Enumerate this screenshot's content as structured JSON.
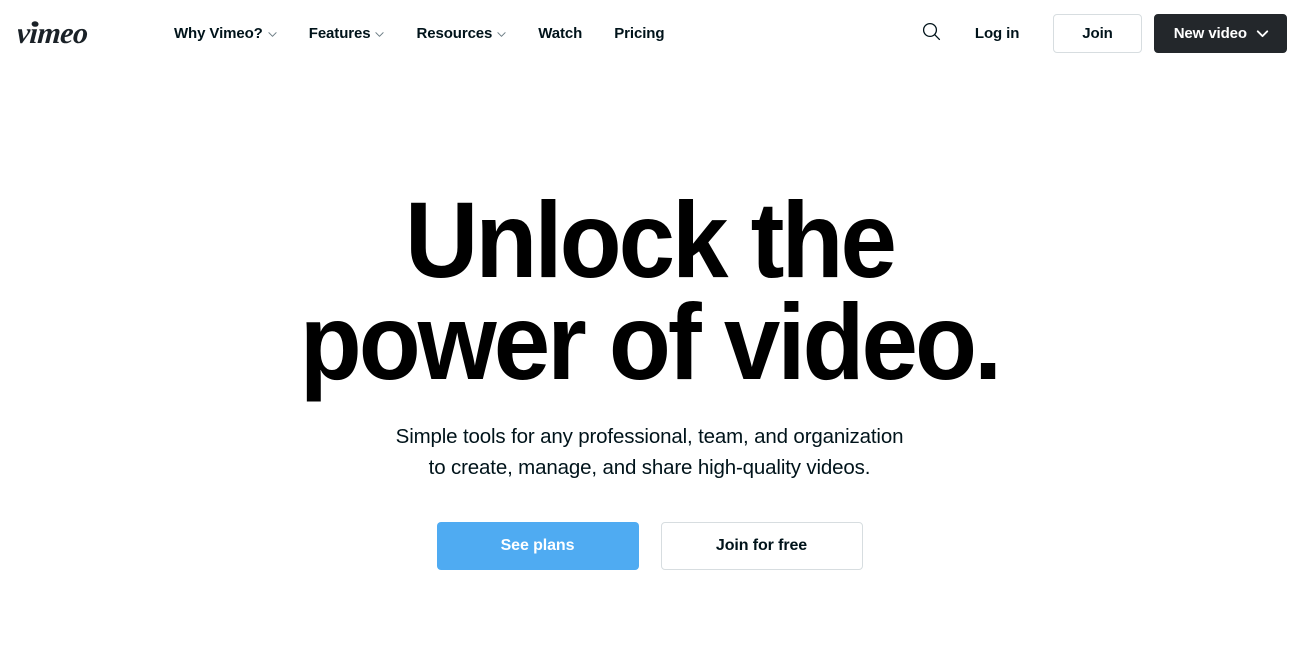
{
  "header": {
    "logo_text": "vimeo",
    "logo_icon": "vimeo-wordmark-logo",
    "nav": [
      {
        "label": "Why Vimeo?",
        "has_chevron": true,
        "icon": "chevron-down-icon"
      },
      {
        "label": "Features",
        "has_chevron": true,
        "icon": "chevron-down-icon"
      },
      {
        "label": "Resources",
        "has_chevron": true,
        "icon": "chevron-down-icon"
      },
      {
        "label": "Watch",
        "has_chevron": false,
        "icon": ""
      },
      {
        "label": "Pricing",
        "has_chevron": false,
        "icon": ""
      }
    ],
    "search_icon": "search-icon",
    "login_label": "Log in",
    "join_label": "Join",
    "new_video_label": "New video",
    "new_video_icon": "chevron-down-icon"
  },
  "hero": {
    "title_line1": "Unlock the",
    "title_line2": "power of video.",
    "subtitle_line1": "Simple tools for any professional, team, and organization",
    "subtitle_line2": "to create, manage, and share high-quality videos.",
    "cta_primary_label": "See plans",
    "cta_secondary_label": "Join for free"
  },
  "colors": {
    "accent_blue": "#4fabf2",
    "dark_button": "#23272b",
    "text": "#00131a",
    "border": "#d7dde0",
    "background": "#ffffff"
  }
}
